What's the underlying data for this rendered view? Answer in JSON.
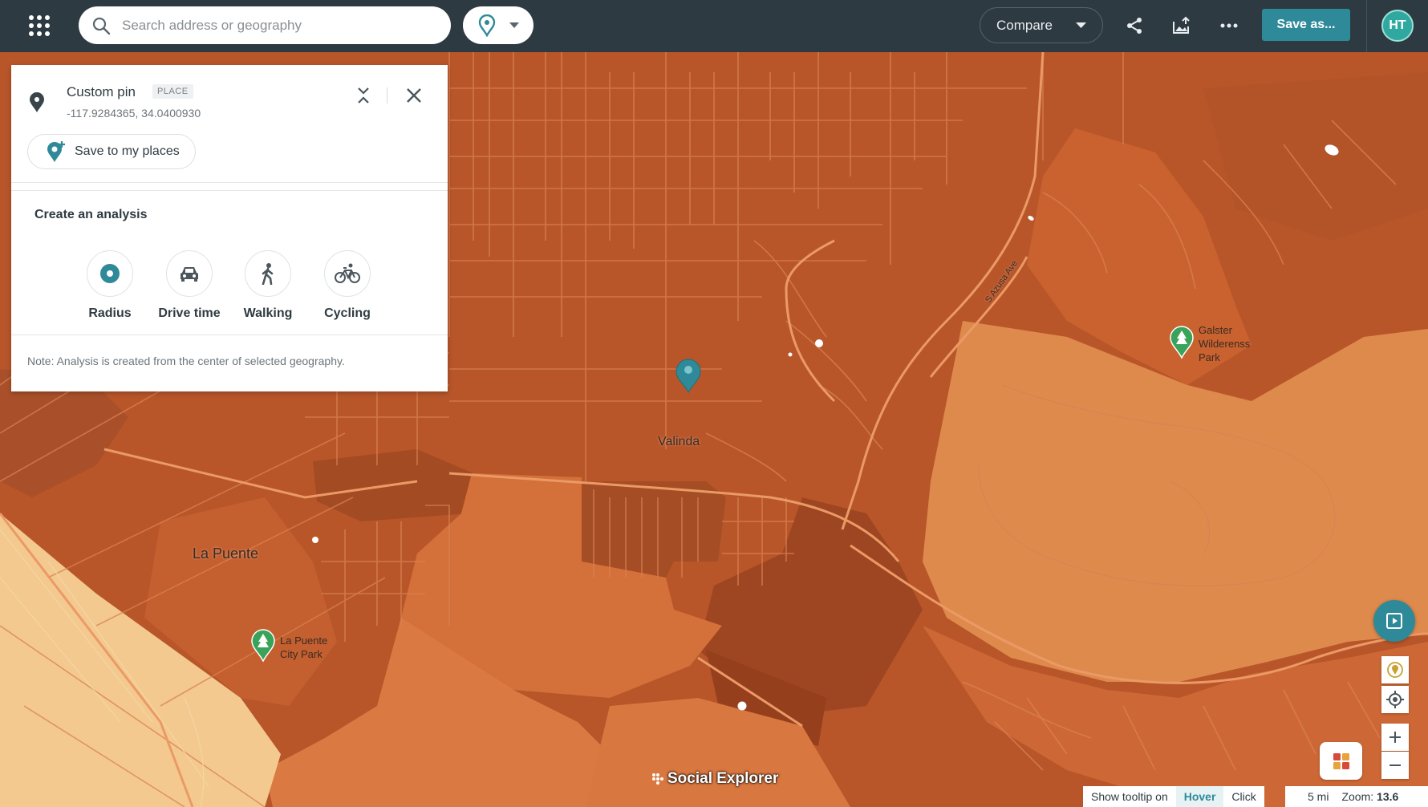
{
  "topbar": {
    "search_placeholder": "Search address or geography",
    "compare_label": "Compare",
    "save_as_label": "Save as...",
    "avatar_initials": "HT"
  },
  "panel": {
    "title": "Custom pin",
    "badge": "PLACE",
    "coordinates": "-117.9284365, 34.0400930",
    "save_label": "Save to my places",
    "analysis_title": "Create an analysis",
    "options": [
      {
        "label": "Radius",
        "icon": "radius-icon"
      },
      {
        "label": "Drive time",
        "icon": "car-icon"
      },
      {
        "label": "Walking",
        "icon": "walking-icon"
      },
      {
        "label": "Cycling",
        "icon": "bicycle-icon"
      }
    ],
    "note": "Note: Analysis is created from the center of selected geography."
  },
  "map": {
    "labels": {
      "valinda": "Valinda",
      "la_puente": "La Puente",
      "road": "S Azusa Ave",
      "galster_1": "Galster",
      "galster_2": "Wilderenss",
      "galster_3": "Park",
      "lapuente_park_1": "La Puente",
      "lapuente_park_2": "City Park"
    },
    "brand": "Social Explorer",
    "colors": {
      "dark": "#a24a22",
      "mid": "#b8562a",
      "light": "#d9773e",
      "lighter": "#e39454",
      "pale": "#f3c98f",
      "accent": "#2e8a98"
    }
  },
  "footer": {
    "tooltip_label": "Show tooltip on",
    "hover": "Hover",
    "click": "Click",
    "scale": "5 mi",
    "zoom_label": "Zoom:",
    "zoom_value": "13.6"
  }
}
